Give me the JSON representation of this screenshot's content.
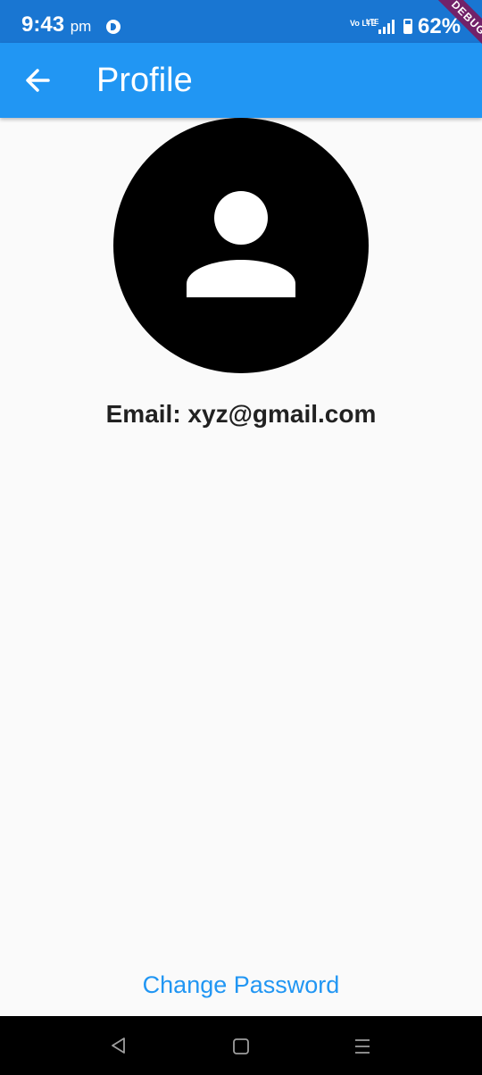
{
  "status_bar": {
    "time": "9:43",
    "ampm": "pm",
    "volte": "Vo LTE",
    "network": "LTE",
    "battery_percent": "62%"
  },
  "debug_banner": "DEBUG",
  "app_bar": {
    "title": "Profile",
    "back_icon": "arrow-left-icon"
  },
  "profile": {
    "avatar_icon": "person-icon",
    "email_text": "Email: xyz@gmail.com"
  },
  "actions": {
    "change_password_label": "Change Password"
  },
  "nav_bar": {
    "back_icon": "triangle-back-icon",
    "home_icon": "square-home-icon",
    "menu_icon": "menu-lines-icon"
  },
  "colors": {
    "status_bar": "#1976d2",
    "app_bar": "#2196f3",
    "accent_text": "#2196f3",
    "background": "#fafafa",
    "debug_banner": "#880e4f"
  }
}
